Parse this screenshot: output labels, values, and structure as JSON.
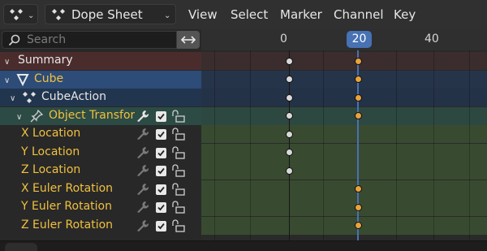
{
  "header": {
    "editor_icon": "dope-sheet-icon",
    "mode": {
      "label": "Dope Sheet",
      "icon": "dope-sheet-icon"
    },
    "menus": [
      "View",
      "Select",
      "Marker",
      "Channel",
      "Key"
    ]
  },
  "channels": {
    "search_placeholder": "Search",
    "rows": [
      {
        "label": "Summary",
        "color": "#e6e6e6"
      },
      {
        "label": "Cube",
        "color": "#f0c040",
        "icon": "mesh-object-icon"
      },
      {
        "label": "CubeAction",
        "color": "#e6e6e6",
        "icon": "action-icon"
      },
      {
        "label": "Object Transforms",
        "color": "#f0c040",
        "icon": "pin-icon"
      },
      {
        "label": "X Location",
        "color": "#f0c040"
      },
      {
        "label": "Y Location",
        "color": "#f0c040"
      },
      {
        "label": "Z Location",
        "color": "#f0c040"
      },
      {
        "label": "X Euler Rotation",
        "color": "#f0c040"
      },
      {
        "label": "Y Euler Rotation",
        "color": "#f0c040"
      },
      {
        "label": "Z Euler Rotation",
        "color": "#f0c040"
      }
    ]
  },
  "timeline": {
    "ruler_labels": [
      "0",
      "40"
    ],
    "current_frame": "20",
    "accent_color": "#4772b3"
  }
}
